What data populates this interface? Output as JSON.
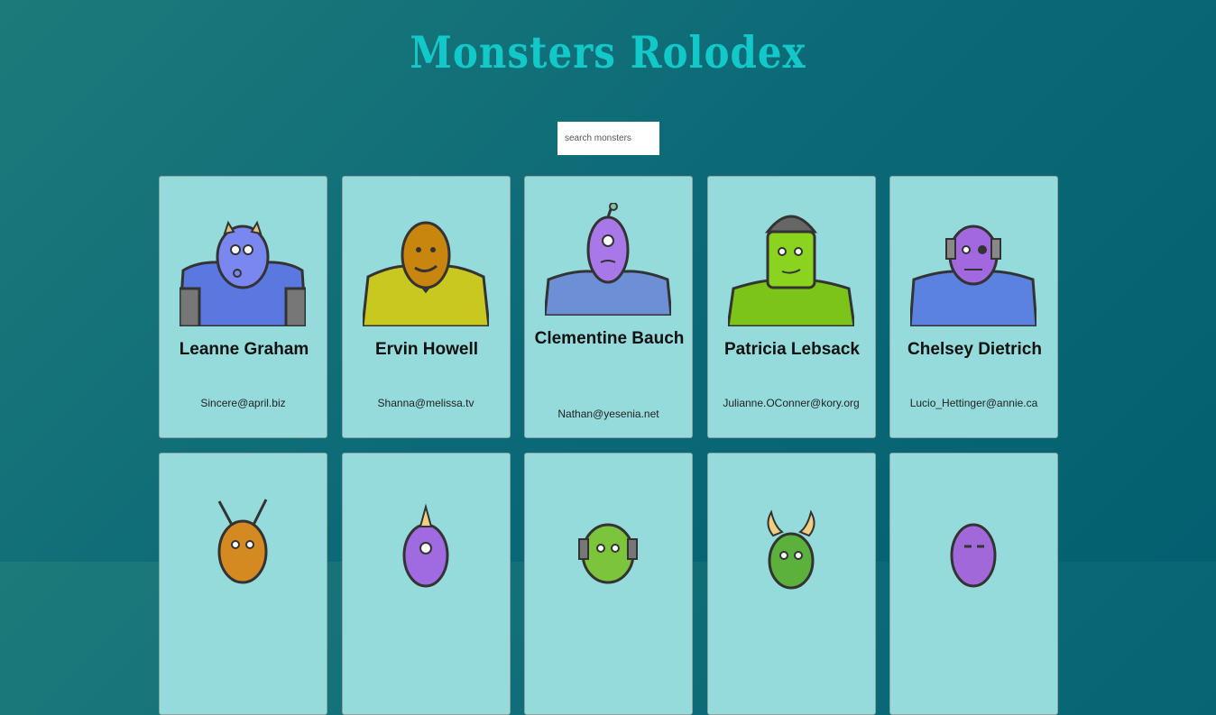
{
  "app": {
    "title": "Monsters Rolodex"
  },
  "search": {
    "placeholder": "search monsters",
    "value": ""
  },
  "monsters": [
    {
      "name": "Leanne Graham",
      "email": "Sincere@april.biz",
      "skin": "#7b87f0",
      "body": "#5b78e0",
      "accent": "#e8c07a"
    },
    {
      "name": "Ervin Howell",
      "email": "Shanna@melissa.tv",
      "skin": "#c8860e",
      "body": "#c8c820",
      "accent": "#333333"
    },
    {
      "name": "Clementine Bauch",
      "email": "Nathan@yesenia.net",
      "skin": "#a978e8",
      "body": "#6d8fd6",
      "accent": "#777777"
    },
    {
      "name": "Patricia Lebsack",
      "email": "Julianne.OConner@kory.org",
      "skin": "#8ad420",
      "body": "#7cc41a",
      "accent": "#666666"
    },
    {
      "name": "Chelsey Dietrich",
      "email": "Lucio_Hettinger@annie.ca",
      "skin": "#a168e0",
      "body": "#5b82e0",
      "accent": "#888888"
    },
    {
      "name": "",
      "email": "",
      "skin": "#d48a20",
      "body": "#7a6ad8",
      "accent": "#333333"
    },
    {
      "name": "",
      "email": "",
      "skin": "#a06ae0",
      "body": "#7060d0",
      "accent": "#f0d080"
    },
    {
      "name": "",
      "email": "",
      "skin": "#7cc43c",
      "body": "#9a6ad8",
      "accent": "#777777"
    },
    {
      "name": "",
      "email": "",
      "skin": "#5cb03c",
      "body": "#4a9a40",
      "accent": "#f0d080"
    },
    {
      "name": "",
      "email": "",
      "skin": "#a068d8",
      "body": "#6a88d0",
      "accent": "#555555"
    }
  ]
}
